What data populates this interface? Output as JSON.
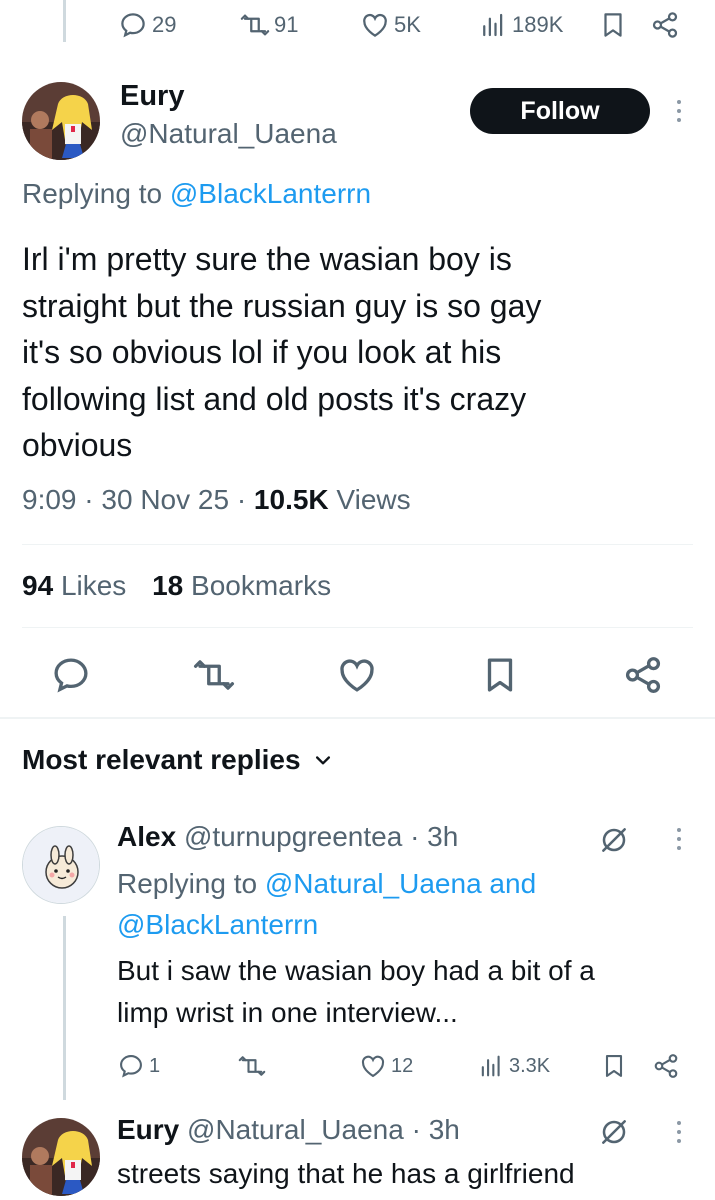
{
  "top_actions": {
    "replies": "29",
    "reposts": "91",
    "likes": "5K",
    "views": "189K"
  },
  "main_tweet": {
    "name": "Eury",
    "handle": "@Natural_Uaena",
    "follow_label": "Follow",
    "replying_prefix": "Replying to",
    "replying_to": "@BlackLanterrn",
    "text_lines": [
      "Irl i'm pretty sure the wasian boy is",
      "straight but the russian guy is so gay",
      "it's so obvious lol if you look at his",
      "following list and old posts it's crazy",
      "obvious"
    ],
    "time": "9:09",
    "sep": "·",
    "date": "30 Nov 25",
    "views_count": "10.5K",
    "views_label": "Views",
    "likes_count": "94",
    "likes_label": "Likes",
    "bookmarks_count": "18",
    "bookmarks_label": "Bookmarks"
  },
  "replies_header": {
    "label": "Most relevant replies"
  },
  "reply1": {
    "name": "Alex",
    "handle": "@turnupgreentea",
    "time": "· 3h",
    "replying_prefix": "Replying to",
    "replying_to": "@Natural_Uaena and",
    "replying_to2": "@BlackLanterrn",
    "text_lines": [
      "But i saw the wasian boy had a bit of a",
      "limp wrist in one interview..."
    ],
    "replies": "1",
    "likes": "12",
    "views": "3.3K"
  },
  "reply2": {
    "name": "Eury",
    "handle": "@Natural_Uaena",
    "time": "· 3h",
    "text_lines": [
      "streets saying that he has a girlfriend"
    ]
  },
  "icons": [
    "reply-icon",
    "repost-icon",
    "like-icon",
    "views-icon",
    "bookmark-icon",
    "share-icon",
    "grok-icon",
    "more-icon",
    "chevron-down-icon"
  ]
}
